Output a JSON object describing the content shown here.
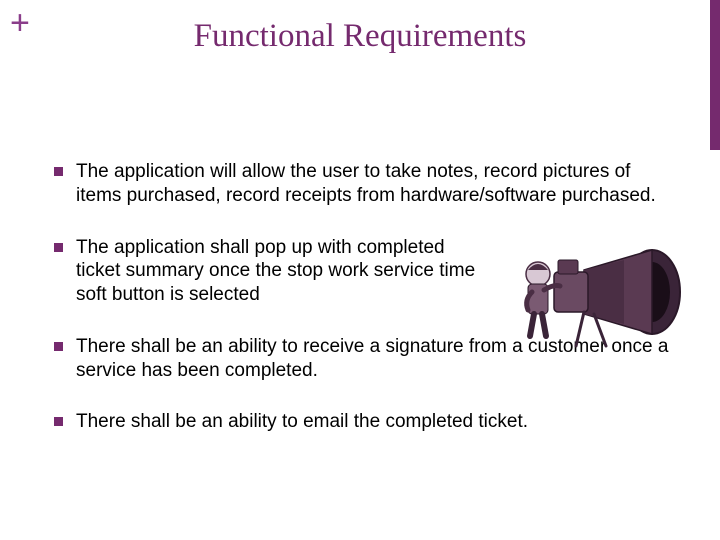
{
  "header": {
    "plus": "+",
    "title": "Functional Requirements"
  },
  "bullets": {
    "b1": "The application will allow the user to take notes, record pictures of items purchased, record receipts from hardware/software purchased.",
    "b2": "The application shall pop up with completed ticket summary once the stop work service time soft button is selected",
    "b3": "There shall be an ability to receive a signature from a customer once a service has been completed.",
    "b4": "There shall be an ability to email the completed ticket."
  },
  "image": {
    "alt": "camera-illustration"
  }
}
